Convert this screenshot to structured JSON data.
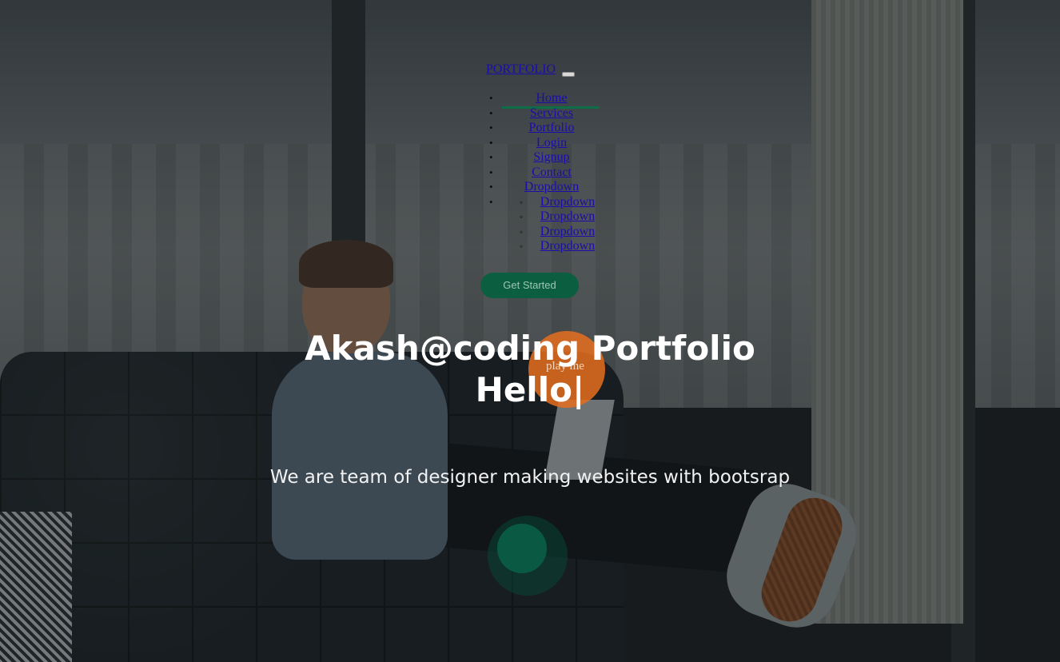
{
  "nav": {
    "brand": "PORTFOLIO",
    "items": [
      {
        "label": "Home"
      },
      {
        "label": "Services"
      },
      {
        "label": "Portfolio"
      },
      {
        "label": "Login"
      },
      {
        "label": "Signup"
      },
      {
        "label": "Contact"
      },
      {
        "label": "Dropdown"
      }
    ],
    "dropdown_items": [
      {
        "label": "Dropdown"
      },
      {
        "label": "Dropdown"
      },
      {
        "label": "Dropdown"
      },
      {
        "label": "Dropdown"
      }
    ]
  },
  "hero": {
    "cta_label": "Get Started",
    "title": "Akash@coding Portfolio",
    "typed_text": "Hello",
    "cursor": "|",
    "play_label": "play me",
    "subtitle": "We are team of designer making websites with bootsrap"
  },
  "colors": {
    "accent_green": "#0b5e3f",
    "play_orange": "#e66e1e",
    "link_blue": "#1a0dab"
  }
}
